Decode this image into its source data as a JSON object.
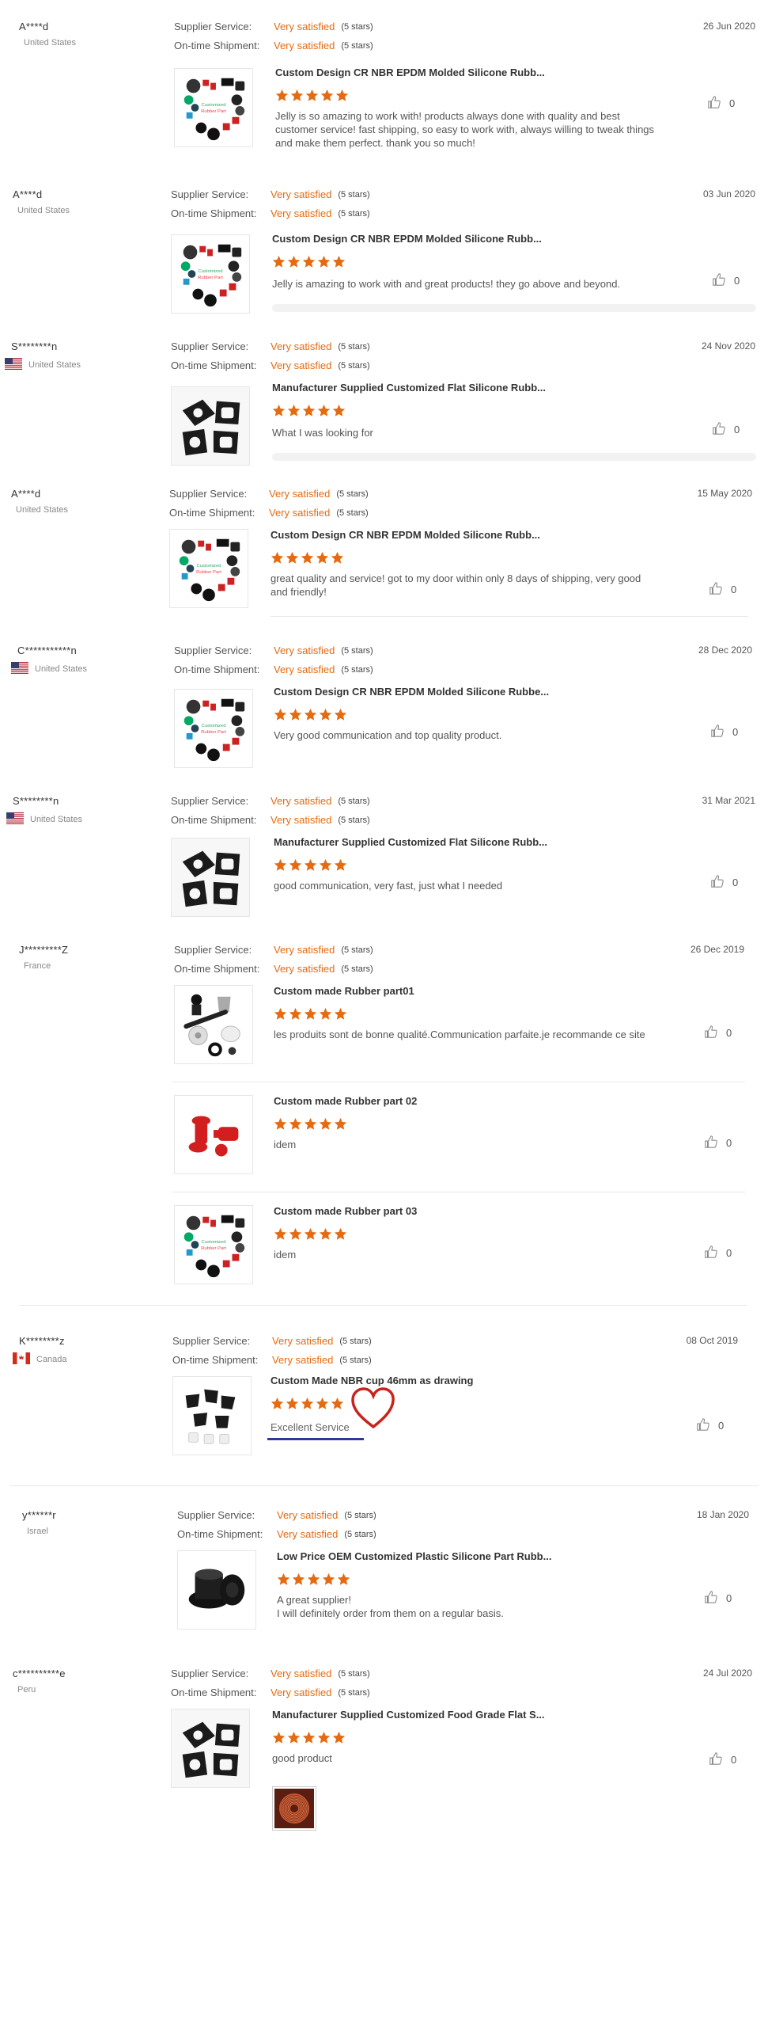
{
  "labels": {
    "supplier_service": "Supplier Service:",
    "ontime_shipment": "On-time Shipment:",
    "rating_value": "Very satisfied",
    "rating_stars": "(5 stars)"
  },
  "colors": {
    "accent": "#e56b12",
    "underline": "#2e3a9a",
    "heart": "#c8231c"
  },
  "reviews": [
    {
      "user": "A****d",
      "country": "United States",
      "flag": "none",
      "date": "26 Jun 2020",
      "products": [
        {
          "title": "Custom Design CR NBR EPDM Molded Silicone Rubb...",
          "rating": 5,
          "comment": "Jelly is so amazing to work with! products always done with quality and best customer service! fast shipping, so easy to work with, always willing to tweak things and make them perfect. thank you so much!",
          "likes": "0",
          "image": "parts-heart-icon"
        }
      ]
    },
    {
      "user": "A****d",
      "country": "United States",
      "flag": "none",
      "date": "03 Jun 2020",
      "products": [
        {
          "title": "Custom Design CR NBR EPDM Molded Silicone Rubb...",
          "rating": 5,
          "comment": "Jelly is amazing to work with and great products! they go above and beyond.",
          "likes": "0",
          "image": "parts-heart-icon"
        }
      ]
    },
    {
      "user": "S********n",
      "country": "United States",
      "flag": "us-flag-icon",
      "date": "24 Nov 2020",
      "products": [
        {
          "title": "Manufacturer Supplied Customized Flat Silicone Rubb...",
          "rating": 5,
          "comment": "What I was looking for",
          "likes": "0",
          "image": "flat-gaskets-icon"
        }
      ]
    },
    {
      "user": "A****d",
      "country": "United States",
      "flag": "none",
      "date": "15 May 2020",
      "products": [
        {
          "title": "Custom Design CR NBR EPDM Molded Silicone Rubb...",
          "rating": 5,
          "comment": "great quality and service! got to my door within only 8 days of shipping, very good and friendly!",
          "likes": "0",
          "image": "parts-heart-icon"
        }
      ]
    },
    {
      "user": "C***********n",
      "country": "United States",
      "flag": "us-flag-icon",
      "date": "28 Dec 2020",
      "products": [
        {
          "title": "Custom Design CR NBR EPDM Molded Silicone Rubbe...",
          "rating": 5,
          "comment": "Very good communication and top quality product.",
          "likes": "0",
          "image": "parts-heart-icon"
        }
      ]
    },
    {
      "user": "S********n",
      "country": "United States",
      "flag": "us-flag-icon",
      "date": "31 Mar 2021",
      "products": [
        {
          "title": "Manufacturer Supplied Customized Flat Silicone Rubb...",
          "rating": 5,
          "comment": "good communication, very fast, just what I needed",
          "likes": "0",
          "image": "flat-gaskets-icon"
        }
      ]
    },
    {
      "user": "J*********Z",
      "country": "France",
      "flag": "none",
      "date": "26 Dec 2019",
      "products": [
        {
          "title": "Custom made Rubber part01",
          "rating": 5,
          "comment": "les produits sont de bonne qualité.Communication parfaite.je recommande ce site",
          "likes": "0",
          "image": "rubber-parts-grey-icon"
        },
        {
          "title": "Custom made Rubber part 02",
          "rating": 5,
          "comment": "idem",
          "likes": "0",
          "image": "red-plugs-icon"
        },
        {
          "title": "Custom made Rubber part 03",
          "rating": 5,
          "comment": "idem",
          "likes": "0",
          "image": "parts-heart-icon"
        }
      ]
    },
    {
      "user": "K********z",
      "country": "Canada",
      "flag": "ca-flag-icon",
      "date": "08 Oct 2019",
      "products": [
        {
          "title": "Custom Made NBR cup 46mm as drawing",
          "rating": 5,
          "comment": "Excellent Service",
          "likes": "0",
          "image": "nbr-cups-icon"
        }
      ]
    },
    {
      "user": "y******r",
      "country": "Israel",
      "flag": "none",
      "date": "18 Jan 2020",
      "products": [
        {
          "title": "Low Price OEM Customized Plastic Silicone Part Rubb...",
          "rating": 5,
          "comment": "A great supplier!\nI will definitely order from them on a regular basis.",
          "likes": "0",
          "image": "black-cap-icon"
        }
      ]
    },
    {
      "user": "c**********e",
      "country": "Peru",
      "flag": "none",
      "date": "24 Jul 2020",
      "products": [
        {
          "title": "Manufacturer Supplied Customized Food Grade Flat S...",
          "rating": 5,
          "comment": "good product",
          "likes": "0",
          "image": "flat-gaskets-icon",
          "attachment": "red-coil-photo-icon"
        }
      ]
    }
  ]
}
